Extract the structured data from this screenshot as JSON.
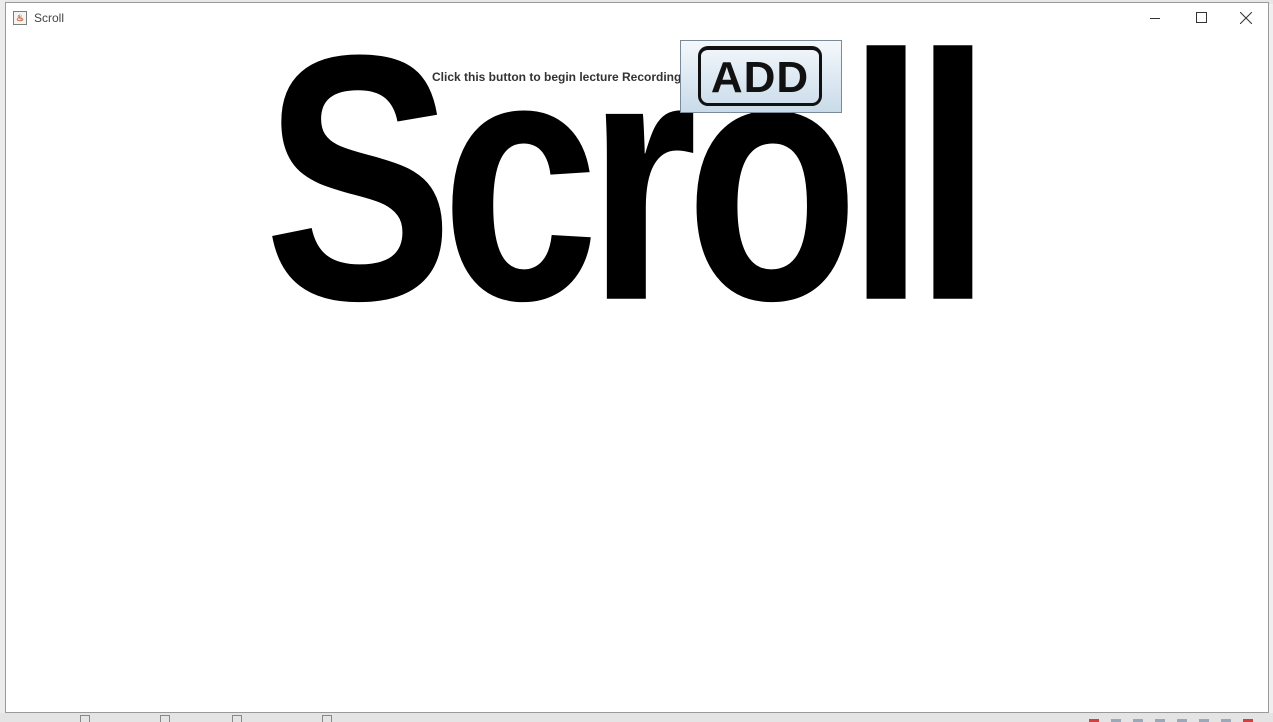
{
  "window": {
    "title": "Scroll",
    "icon": "java-cup-icon"
  },
  "controls": {
    "minimize": "minimize-icon",
    "maximize": "maximize-icon",
    "close": "close-icon"
  },
  "content": {
    "hint_label": "Click this button to begin lecture Recording",
    "add_button_label": "ADD",
    "banner_text": "Scroll"
  }
}
